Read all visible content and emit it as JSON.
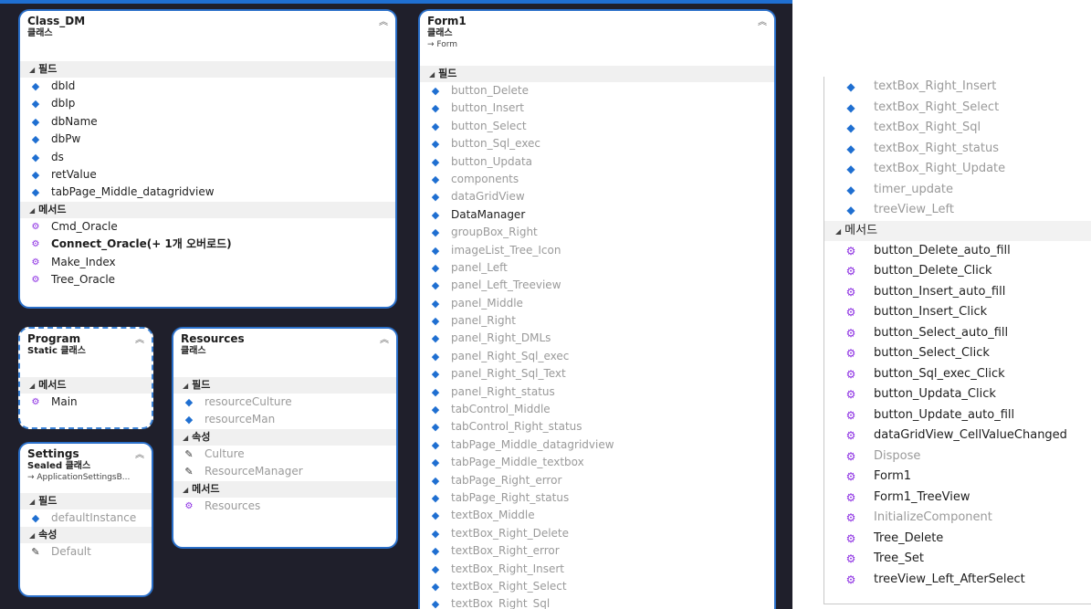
{
  "class_dm": {
    "title": "Class_DM",
    "kind": "클래스",
    "fields_label": "필드",
    "fields": [
      "dbId",
      "dbIp",
      "dbName",
      "dbPw",
      "ds",
      "retValue",
      "tabPage_Middle_datagridview"
    ],
    "methods_label": "메서드",
    "methods": [
      "Cmd_Oracle",
      "Connect_Oracle(+ 1개 오버로드)",
      "Make_Index",
      "Tree_Oracle"
    ]
  },
  "program": {
    "title": "Program",
    "kind": "Static 클래스",
    "methods_label": "메서드",
    "methods": [
      "Main"
    ]
  },
  "resources": {
    "title": "Resources",
    "kind": "클래스",
    "fields_label": "필드",
    "fields": [
      "resourceCulture",
      "resourceMan"
    ],
    "props_label": "속성",
    "props": [
      "Culture",
      "ResourceManager"
    ],
    "methods_label": "메서드",
    "methods": [
      "Resources"
    ]
  },
  "settings": {
    "title": "Settings",
    "kind": "Sealed 클래스",
    "base": "→ ApplicationSettingsB...",
    "fields_label": "필드",
    "fields": [
      "defaultInstance"
    ],
    "props_label": "속성",
    "props": [
      "Default"
    ]
  },
  "form1": {
    "title": "Form1",
    "kind": "클래스",
    "base": "→ Form",
    "fields_label": "필드",
    "fields": [
      "button_Delete",
      "button_Insert",
      "button_Select",
      "button_Sql_exec",
      "button_Updata",
      "components",
      "dataGridView",
      "DataManager",
      "groupBox_Right",
      "imageList_Tree_Icon",
      "panel_Left",
      "panel_Left_Treeview",
      "panel_Middle",
      "panel_Right",
      "panel_Right_DMLs",
      "panel_Right_Sql_exec",
      "panel_Right_Sql_Text",
      "panel_Right_status",
      "tabControl_Middle",
      "tabControl_Right_status",
      "tabPage_Middle_datagridview",
      "tabPage_Middle_textbox",
      "tabPage_Right_error",
      "tabPage_Right_status",
      "textBox_Middle",
      "textBox_Right_Delete",
      "textBox_Right_error",
      "textBox_Right_Insert",
      "textBox_Right_Select",
      "textBox_Right_Sql"
    ]
  },
  "right_panel": {
    "fields": [
      "textBox_Right_Insert",
      "textBox_Right_Select",
      "textBox_Right_Sql",
      "textBox_Right_status",
      "textBox_Right_Update",
      "timer_update",
      "treeView_Left"
    ],
    "methods_label": "메서드",
    "methods": [
      "button_Delete_auto_fill",
      "button_Delete_Click",
      "button_Insert_auto_fill",
      "button_Insert_Click",
      "button_Select_auto_fill",
      "button_Select_Click",
      "button_Sql_exec_Click",
      "button_Updata_Click",
      "button_Update_auto_fill",
      "dataGridView_CellValueChanged",
      "Dispose",
      "Form1",
      "Form1_TreeView",
      "InitializeComponent",
      "Tree_Delete",
      "Tree_Set",
      "treeView_Left_AfterSelect"
    ]
  },
  "icons": {
    "collapse": "chevron-up-double",
    "field": "field-icon",
    "method": "method-icon",
    "property": "wrench-icon"
  },
  "colors": {
    "canvas": "#1f1f2b",
    "border": "#2a6fc9",
    "field_icon": "#1f6fd1",
    "method_icon": "#8a2be2"
  }
}
